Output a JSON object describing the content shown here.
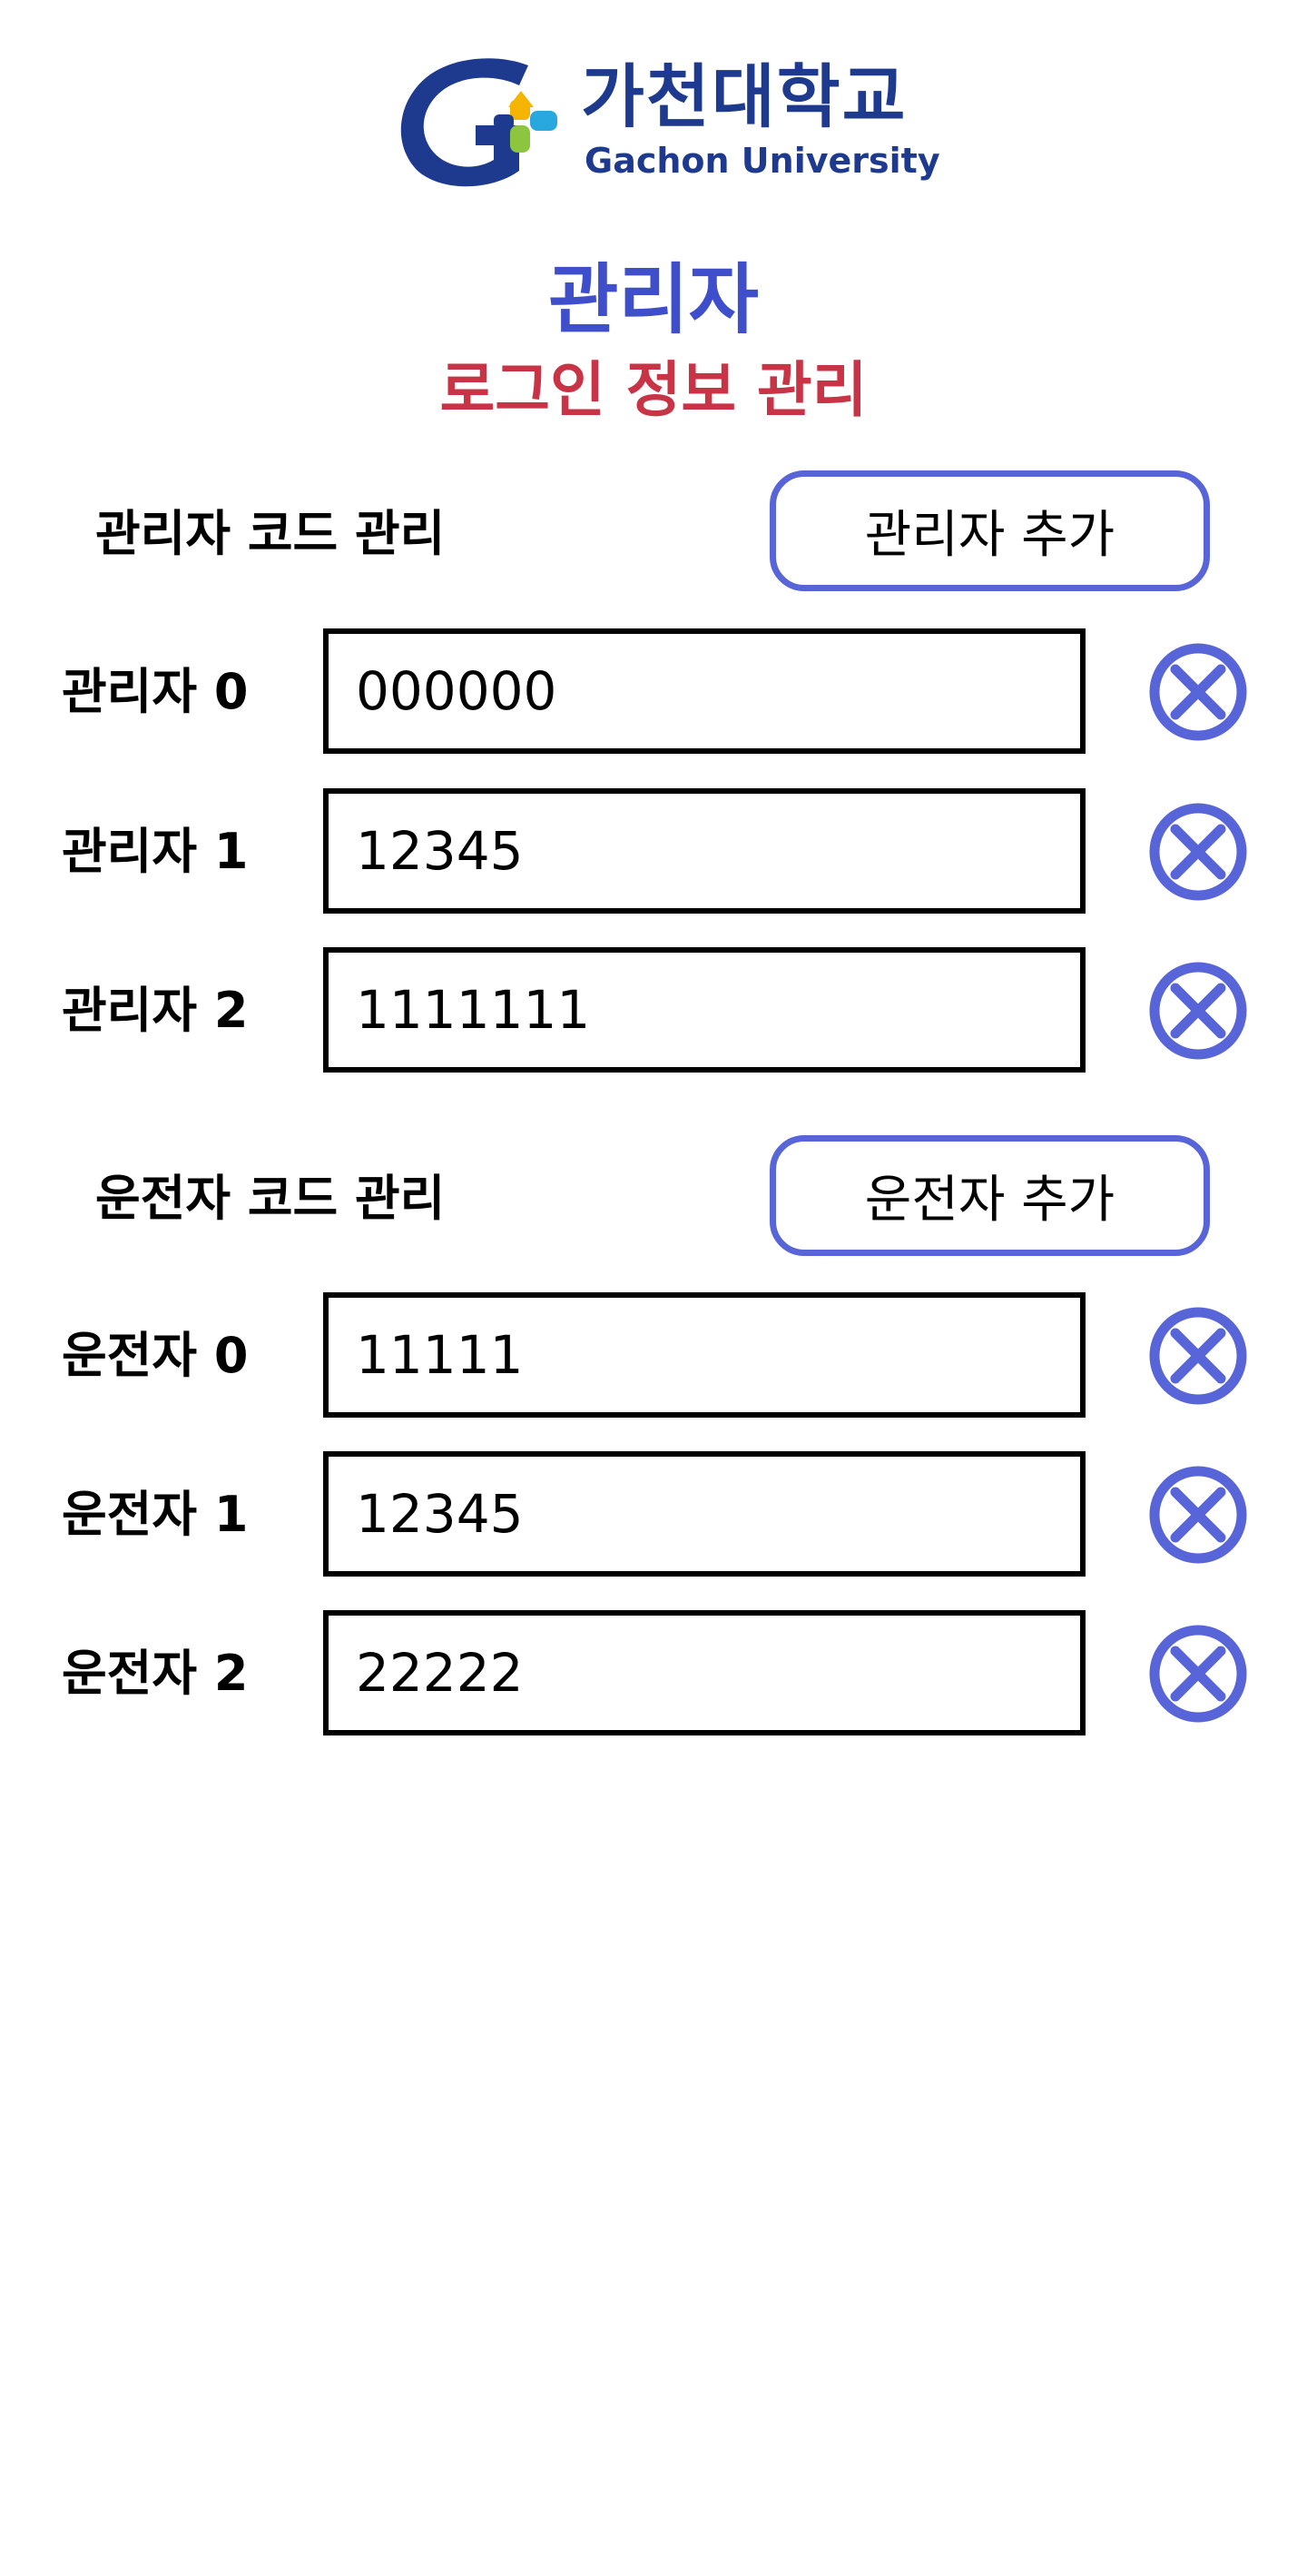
{
  "logo": {
    "korean_name": "가천대학교",
    "english_name": "Gachon University",
    "colors": {
      "brand_blue": "#1d3a8f",
      "yellow": "#f5b400",
      "cyan": "#29a8e0",
      "green": "#8cc63f"
    }
  },
  "header": {
    "title": "관리자",
    "subtitle": "로그인 정보 관리"
  },
  "admin_section": {
    "label": "관리자 코드 관리",
    "add_button": "관리자 추가",
    "rows": [
      {
        "label": "관리자 0",
        "value": "000000"
      },
      {
        "label": "관리자 1",
        "value": "12345"
      },
      {
        "label": "관리자 2",
        "value": "1111111"
      }
    ]
  },
  "driver_section": {
    "label": "운전자 코드 관리",
    "add_button": "운전자 추가",
    "rows": [
      {
        "label": "운전자 0",
        "value": "11111"
      },
      {
        "label": "운전자 1",
        "value": "12345"
      },
      {
        "label": "운전자 2",
        "value": "22222"
      }
    ]
  },
  "icons": {
    "delete": "close-circle-icon"
  },
  "colors": {
    "title": "#3f4fcc",
    "subtitle": "#c93346",
    "accent": "#5865d9"
  }
}
